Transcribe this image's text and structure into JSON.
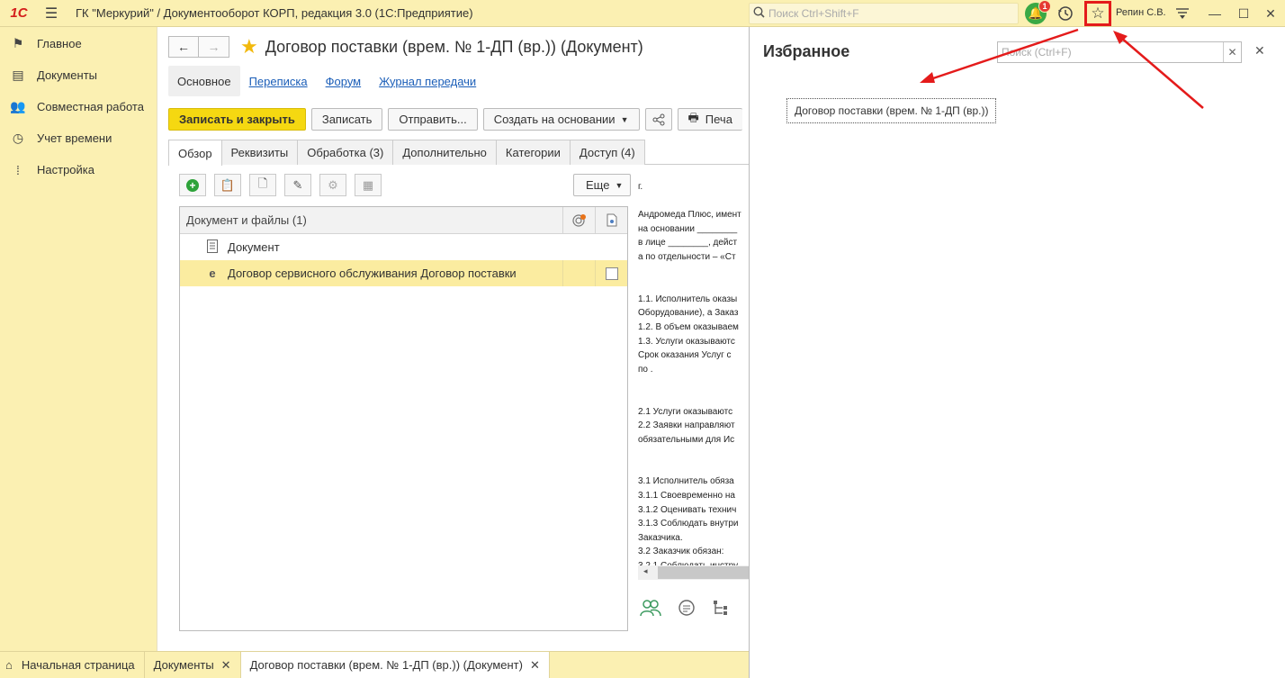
{
  "app": {
    "logo_text": "1С",
    "title": "ГК \"Меркурий\" / Документооборот КОРП, редакция 3.0  (1С:Предприятие)",
    "search_placeholder": "Поиск Ctrl+Shift+F",
    "notifications_count": "1",
    "user_name": "Репин С.В."
  },
  "sidebar": {
    "items": [
      {
        "label": "Главное",
        "icon": "flag-icon"
      },
      {
        "label": "Документы",
        "icon": "documents-icon"
      },
      {
        "label": "Совместная работа",
        "icon": "users-icon"
      },
      {
        "label": "Учет времени",
        "icon": "clock-icon"
      },
      {
        "label": "Настройка",
        "icon": "settings-icon"
      }
    ]
  },
  "document": {
    "title": "Договор поставки (врем. № 1-ДП (вр.)) (Документ)",
    "subtabs": [
      "Основное",
      "Переписка",
      "Форум",
      "Журнал передачи"
    ],
    "toolbar": {
      "save_close": "Записать и закрыть",
      "save": "Записать",
      "send": "Отправить...",
      "create_based": "Создать на основании",
      "print": "Печа"
    },
    "tabs": [
      "Обзор",
      "Реквизиты",
      "Обработка (3)",
      "Дополнительно",
      "Категории",
      "Доступ (4)"
    ],
    "more_label": "Еще",
    "files": {
      "header": "Документ и файлы (1)",
      "rows": [
        {
          "label": "Документ"
        },
        {
          "label": "Договор сервисного обслуживания Договор поставки"
        }
      ]
    },
    "preview_lines": [
      "г.",
      "",
      "Андромеда Плюс, имент",
      " на  основании ________",
      "в лице ________, дейст",
      "а по отдельности – «Ст",
      "",
      "",
      "1.1. Исполнитель оказы",
      "Оборудование), а Заказ",
      "1.2. В объем оказываем",
      "1.3. Услуги оказываютс",
      " Срок оказания Услуг с",
      "по .",
      "",
      "",
      "2.1 Услуги оказываютс",
      "2.2 Заявки направляют",
      "обязательными для Ис",
      "",
      "",
      "3.1  Исполнитель обяза",
      "3.1.1 Своевременно на",
      "3.1.2 Оценивать технич",
      "3.1.3 Соблюдать внутри",
      "Заказчика.",
      "3.2 Заказчик обязан:",
      "3.2.1 Соблюдать инстру"
    ]
  },
  "favorites": {
    "title": "Избранное",
    "search_placeholder": "Поиск (Ctrl+F)",
    "items": [
      "Договор поставки (врем. № 1-ДП (вр.))"
    ]
  },
  "taskbar": {
    "items": [
      {
        "label": "Начальная страница"
      },
      {
        "label": "Документы"
      },
      {
        "label": "Договор поставки (врем. № 1-ДП (вр.)) (Документ)"
      }
    ]
  },
  "colors": {
    "accent_yellow": "#fbf0b2",
    "primary_button": "#f5d811",
    "link": "#1b5eb8",
    "annotation_red": "#e41b1b"
  }
}
